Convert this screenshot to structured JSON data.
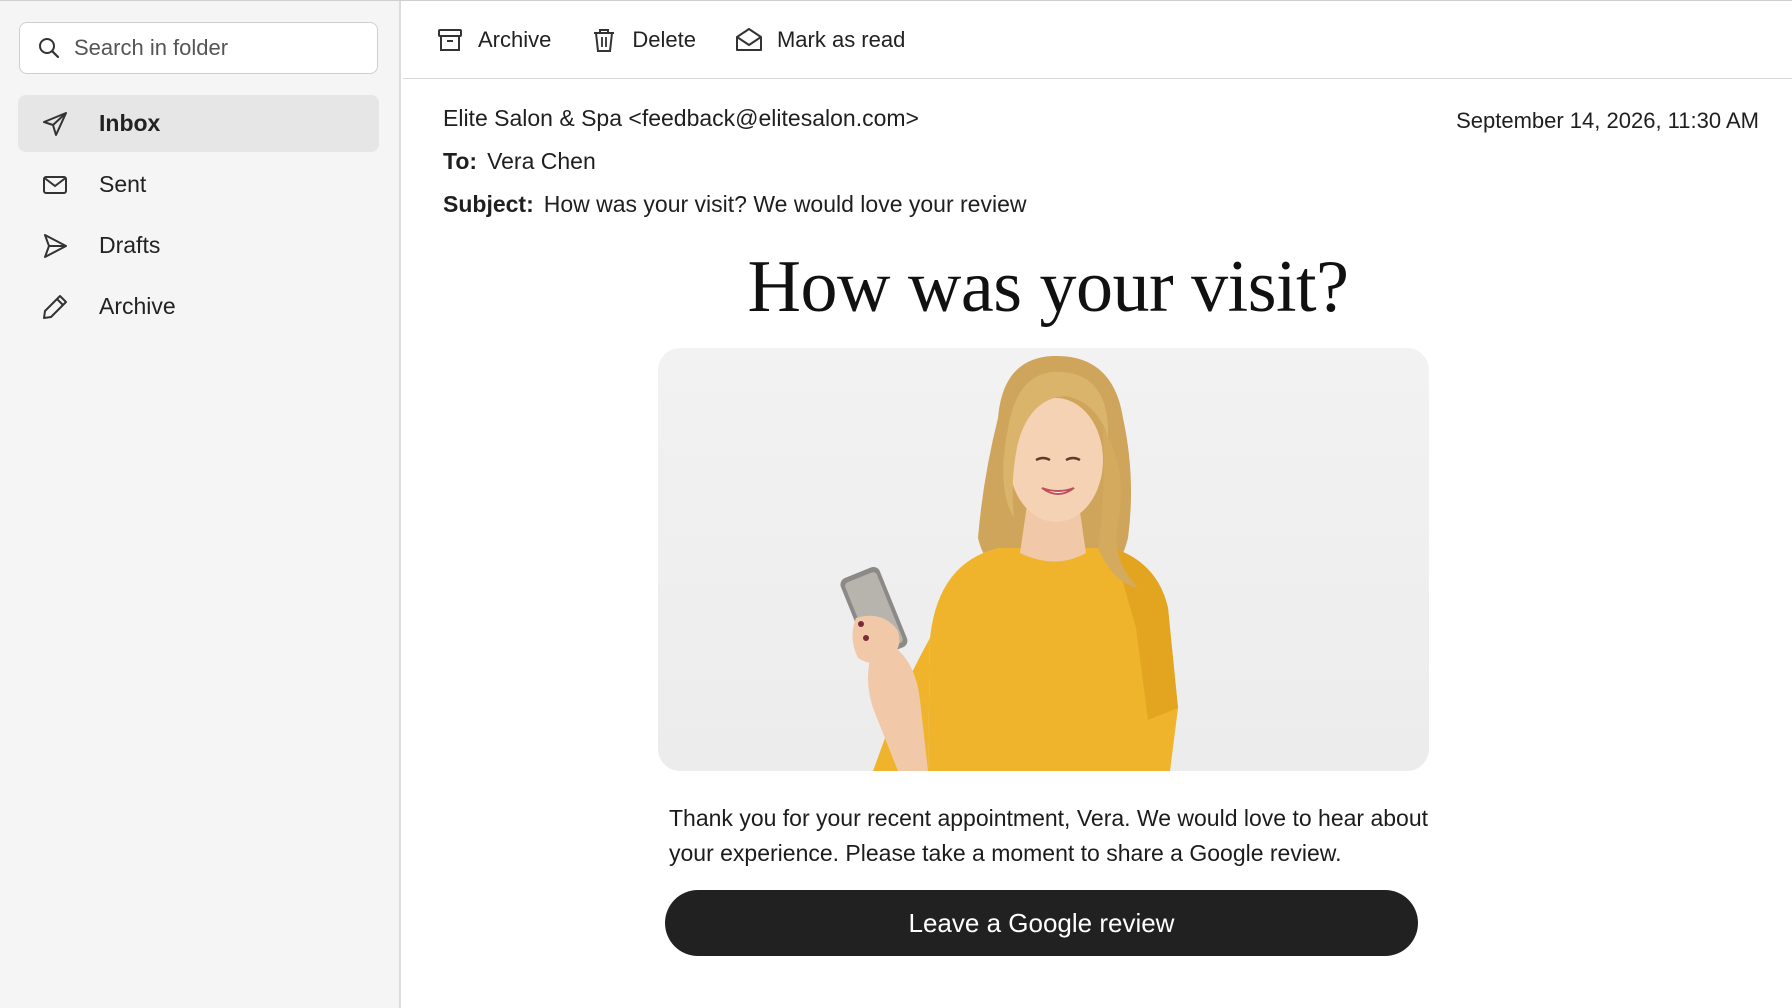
{
  "search": {
    "placeholder": "Search in folder",
    "icon": "search-icon"
  },
  "sidebar": {
    "items": [
      {
        "label": "Inbox",
        "icon": "send-icon",
        "active": true
      },
      {
        "label": "Sent",
        "icon": "envelope-icon",
        "active": false
      },
      {
        "label": "Drafts",
        "icon": "paper-plane-icon",
        "active": false
      },
      {
        "label": "Archive",
        "icon": "pencil-icon",
        "active": false
      }
    ]
  },
  "toolbar": {
    "archive_label": "Archive",
    "delete_label": "Delete",
    "mark_read_label": "Mark as read"
  },
  "message": {
    "from": "Elite Salon & Spa <feedback@elitesalon.com>",
    "date": "September 14, 2026, 11:30 AM",
    "to_key": "To:",
    "to": "Vera Chen",
    "subject_key": "Subject:",
    "subject": "How was your visit? We would love your review"
  },
  "email_body": {
    "headline": "How was your visit?",
    "image_description_icon": "woman-with-phone-photo",
    "text": "Thank you for your recent appointment, Vera. We would love to hear about your experience. Please take a moment to share a Google review.",
    "cta_label": "Leave a Google review"
  },
  "colors": {
    "sidebar_bg": "#f5f5f5",
    "active_item_bg": "#e6e6e6",
    "cta_bg": "#212121",
    "shirt": "#f0b42c",
    "hair": "#d9b46a"
  }
}
